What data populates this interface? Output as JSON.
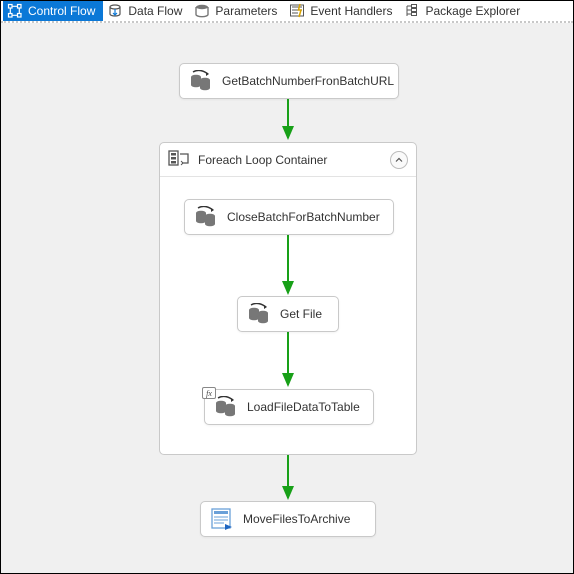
{
  "tabs": {
    "control_flow": "Control Flow",
    "data_flow": "Data Flow",
    "parameters": "Parameters",
    "event_handlers": "Event Handlers",
    "package_explorer": "Package Explorer"
  },
  "nodes": {
    "get_batch": "GetBatchNumberFronBatchURL",
    "foreach_container": "Foreach Loop Container",
    "close_batch": "CloseBatchForBatchNumber",
    "get_file": "Get File",
    "load_file": "LoadFileDataToTable",
    "move_archive": "MoveFilesToArchive"
  },
  "colors": {
    "tab_active": "#0b78d7",
    "arrow": "#18a018",
    "canvas": "#f0f0f0"
  },
  "chart_data": {
    "type": "flow",
    "title": "SSIS Control Flow",
    "nodes": [
      {
        "id": "get_batch",
        "label": "GetBatchNumberFronBatchURL",
        "kind": "sql-task"
      },
      {
        "id": "foreach",
        "label": "Foreach Loop Container",
        "kind": "container",
        "children": [
          "close_batch",
          "get_file",
          "load_file"
        ]
      },
      {
        "id": "close_batch",
        "label": "CloseBatchForBatchNumber",
        "kind": "sql-task"
      },
      {
        "id": "get_file",
        "label": "Get File",
        "kind": "sql-task"
      },
      {
        "id": "load_file",
        "label": "LoadFileDataToTable",
        "kind": "sql-task",
        "has_expression": true
      },
      {
        "id": "move_archive",
        "label": "MoveFilesToArchive",
        "kind": "script-task"
      }
    ],
    "edges": [
      {
        "from": "get_batch",
        "to": "foreach",
        "constraint": "success"
      },
      {
        "from": "close_batch",
        "to": "get_file",
        "constraint": "success"
      },
      {
        "from": "get_file",
        "to": "load_file",
        "constraint": "success"
      },
      {
        "from": "foreach",
        "to": "move_archive",
        "constraint": "success"
      }
    ]
  }
}
